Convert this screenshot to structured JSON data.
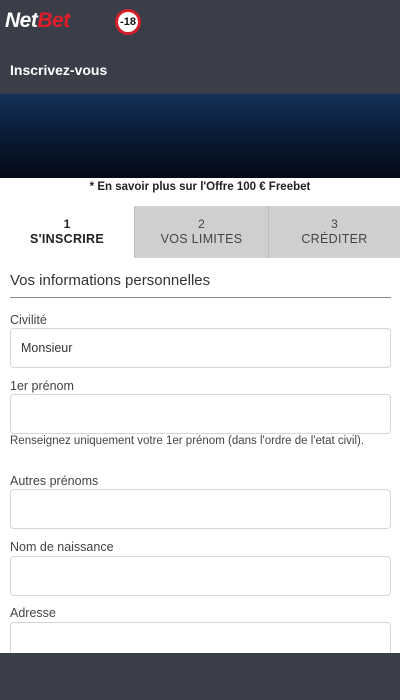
{
  "header": {
    "logo_net": "Net",
    "logo_bet": "Bet",
    "age_badge": "-18",
    "title": "Inscrivez-vous"
  },
  "offer_link": "* En savoir plus sur l'Offre 100 € Freebet",
  "steps": [
    {
      "number": "1",
      "label": "S'INSCRIRE",
      "active": true
    },
    {
      "number": "2",
      "label": "VOS LIMITES",
      "active": false
    },
    {
      "number": "3",
      "label": "CRÉDITER",
      "active": false
    }
  ],
  "form": {
    "section_title": "Vos informations personnelles",
    "civilite": {
      "label": "Civilité",
      "value": "Monsieur"
    },
    "first_name": {
      "label": "1er prénom",
      "value": "",
      "hint": "Renseignez uniquement votre 1er prénom (dans l'ordre de l'etat civil)."
    },
    "other_names": {
      "label": "Autres prénoms",
      "value": ""
    },
    "birth_name": {
      "label": "Nom de naissance",
      "value": ""
    },
    "address": {
      "label": "Adresse",
      "value": ""
    }
  },
  "colors": {
    "header_bg": "#3a3e48",
    "brand_red": "#e21d2a",
    "tab_inactive_bg": "#cfcfcf",
    "banner_dark": "#0b1d38"
  }
}
